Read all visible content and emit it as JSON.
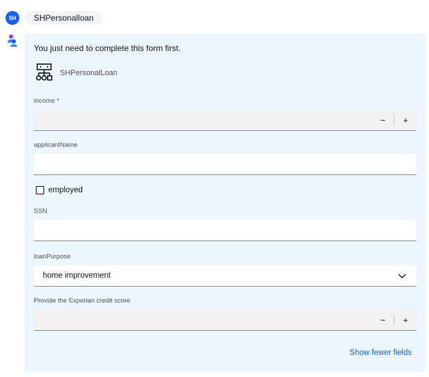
{
  "user": {
    "avatar_initials": "SH",
    "message": "SHPersonalloan"
  },
  "bot": {
    "avatar_icon": "assistant-icon",
    "intro": "You just need to complete this form first.",
    "tool_icon": "workflow-icon",
    "tool_name": "SHPersonalLoan"
  },
  "form": {
    "income": {
      "label": "income *",
      "value": "",
      "decrement": "−",
      "increment": "+"
    },
    "applicantName": {
      "label": "applicantName",
      "value": ""
    },
    "employed": {
      "label": "employed",
      "checked": false
    },
    "ssn": {
      "label": "SSN",
      "value": ""
    },
    "loanPurpose": {
      "label": "loanPurpose",
      "value": "home improvement"
    },
    "creditScore": {
      "label": "Provide the Experian credit score",
      "value": "",
      "decrement": "−",
      "increment": "+"
    },
    "toggle_fields": "Show fewer fields"
  },
  "colors": {
    "accent": "#0f62fe",
    "card_background": "#edf5ff"
  }
}
